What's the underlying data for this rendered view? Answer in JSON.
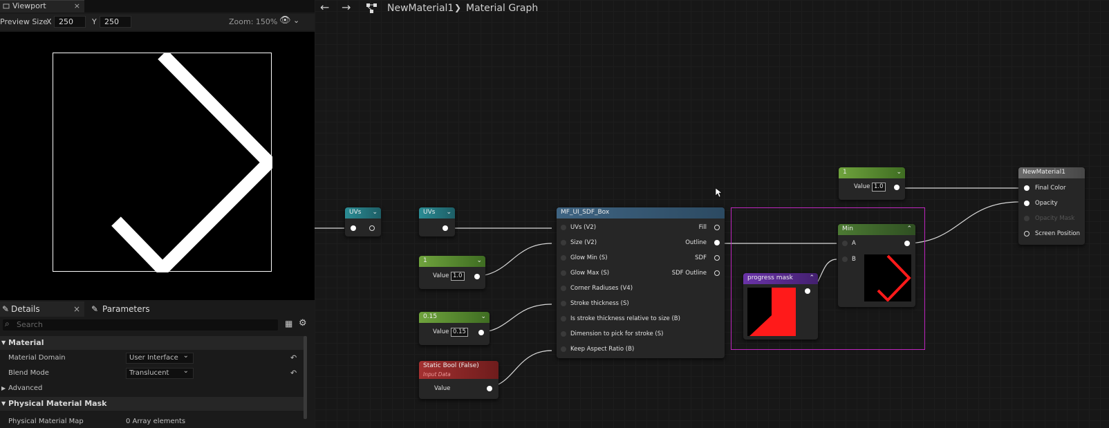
{
  "viewport_tab": {
    "label": "Viewport",
    "close": "×"
  },
  "preview": {
    "label": "Preview Size",
    "x_label": "X",
    "x_value": "250",
    "y_label": "Y",
    "y_value": "250",
    "zoom": "Zoom: 150%"
  },
  "details_tab": {
    "label": "Details",
    "close": "×"
  },
  "parameters_tab": {
    "label": "Parameters"
  },
  "search": {
    "placeholder": "Search"
  },
  "sections": {
    "material": "Material",
    "advanced": "Advanced",
    "physical_mask": "Physical Material Mask"
  },
  "props": [
    {
      "label": "Material Domain",
      "value": "User Interface"
    },
    {
      "label": "Blend Mode",
      "value": "Translucent"
    }
  ],
  "cutoff_row": {
    "label": "Physical Material Map",
    "value": "0 Array elements"
  },
  "breadcrumb": {
    "asset": "NewMaterial1",
    "sep": "❯",
    "graph": "Material Graph"
  },
  "nodes": {
    "uvs1": {
      "title": "UVs"
    },
    "uvs2": {
      "title": "UVs"
    },
    "const1": {
      "title": "1",
      "value_label": "Value",
      "value": "1.0"
    },
    "const015": {
      "title": "0.15",
      "value_label": "Value",
      "value": "0.15"
    },
    "static_bool": {
      "title": "Static Bool (False)",
      "subtitle": "Input Data",
      "value_label": "Value"
    },
    "sdf_box": {
      "title": "MF_UI_SDF_Box",
      "inputs": [
        "UVs (V2)",
        "Size (V2)",
        "Glow Min (S)",
        "Glow Max (S)",
        "Corner Radiuses (V4)",
        "Stroke thickness (S)",
        "Is stroke thickness relative to size (B)",
        "Dimension to pick for stroke (S)",
        "Keep Aspect Ratio (B)"
      ],
      "outputs": [
        "Fill",
        "Outline",
        "SDF",
        "SDF Outline"
      ]
    },
    "progress_mask": {
      "title": "progress mask"
    },
    "min": {
      "title": "Min",
      "a": "A",
      "b": "B"
    },
    "const_top": {
      "title": "1",
      "value_label": "Value",
      "value": "1.0"
    },
    "result": {
      "title": "NewMaterial1",
      "pins": [
        "Final Color",
        "Opacity",
        "Opacity Mask",
        "Screen Position"
      ]
    }
  },
  "colors": {
    "selection": "#c026c0",
    "mask_red": "#ff1a1a"
  }
}
